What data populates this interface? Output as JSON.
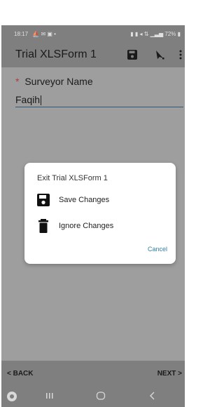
{
  "status_bar": {
    "time": "18:17",
    "left_icons": "⛵ ✉ ▣ •",
    "right_text": "72%"
  },
  "app_bar": {
    "title": "Trial XLSForm 1",
    "icons": [
      "save-icon",
      "send-icon",
      "more-icon"
    ]
  },
  "question": {
    "required_mark": "*",
    "label": "Surveyor Name",
    "value": "Faqih"
  },
  "dialog": {
    "title": "Exit Trial XLSForm 1",
    "options": [
      {
        "label": "Save Changes",
        "icon": "save-icon"
      },
      {
        "label": "Ignore Changes",
        "icon": "trash-icon"
      }
    ],
    "cancel_label": "Cancel"
  },
  "bottom_bar": {
    "back_label": "< BACK",
    "next_label": "NEXT >"
  },
  "colors": {
    "overlay": "#9e9e9e",
    "accent": "#2f7fa8",
    "required": "#b33b3b"
  }
}
